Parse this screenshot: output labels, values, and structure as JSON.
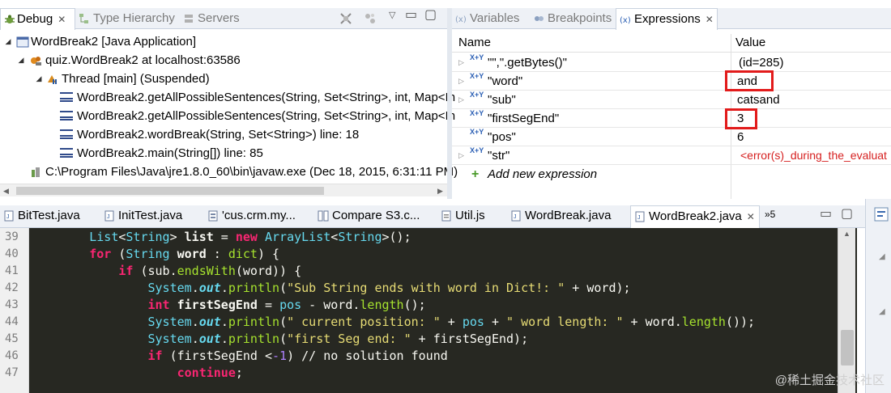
{
  "debug_view": {
    "tabs": [
      {
        "label": "Debug",
        "active": true
      },
      {
        "label": "Type Hierarchy",
        "active": false
      },
      {
        "label": "Servers",
        "active": false
      }
    ],
    "tree": [
      {
        "label": "WordBreak2 [Java Application]"
      },
      {
        "label": "quiz.WordBreak2 at localhost:63586"
      },
      {
        "label": "Thread [main] (Suspended)"
      },
      {
        "label": "WordBreak2.getAllPossibleSentences(String, Set<String>, int, Map<In"
      },
      {
        "label": "WordBreak2.getAllPossibleSentences(String, Set<String>, int, Map<In"
      },
      {
        "label": "WordBreak2.wordBreak(String, Set<String>) line: 18"
      },
      {
        "label": "WordBreak2.main(String[]) line: 85"
      },
      {
        "label": "C:\\Program Files\\Java\\jre1.8.0_60\\bin\\javaw.exe (Dec 18, 2015, 6:31:11 PM)"
      }
    ]
  },
  "variables_view": {
    "tabs": [
      {
        "label": "Variables",
        "active": false
      },
      {
        "label": "Breakpoints",
        "active": false
      },
      {
        "label": "Expressions",
        "active": true
      }
    ],
    "columns": {
      "name": "Name",
      "value": "Value"
    },
    "rows": [
      {
        "name": "\"\",\".getBytes()\"",
        "value": "(id=285)"
      },
      {
        "name": "\"word\"",
        "value": "and"
      },
      {
        "name": "\"sub\"",
        "value": "catsand"
      },
      {
        "name": "\"firstSegEnd\"",
        "value": "3"
      },
      {
        "name": "\"pos\"",
        "value": "6"
      },
      {
        "name": "\"str\"",
        "value": "<error(s)_during_the_evaluat"
      }
    ],
    "add_label": "Add new expression",
    "error_color": "#d62020"
  },
  "editor_tabs": [
    {
      "label": "BitTest.java"
    },
    {
      "label": "InitTest.java"
    },
    {
      "label": "'cus.crm.my..."
    },
    {
      "label": "Compare S3.c..."
    },
    {
      "label": "Util.js"
    },
    {
      "label": "WordBreak.java"
    },
    {
      "label": "WordBreak2.java",
      "active": true
    }
  ],
  "overflow_label": "»5",
  "editor": {
    "line_numbers": [
      "39",
      "40",
      "41",
      "42",
      "43",
      "44",
      "45",
      "46",
      "47"
    ]
  },
  "watermark": "@稀土掘金技术社区",
  "colors": {
    "editor_bg": "#272822",
    "keyword": "#f92672",
    "type": "#66d9ef",
    "string": "#e6db74",
    "method": "#a6e22e",
    "highlight_box": "#e21b1b"
  }
}
